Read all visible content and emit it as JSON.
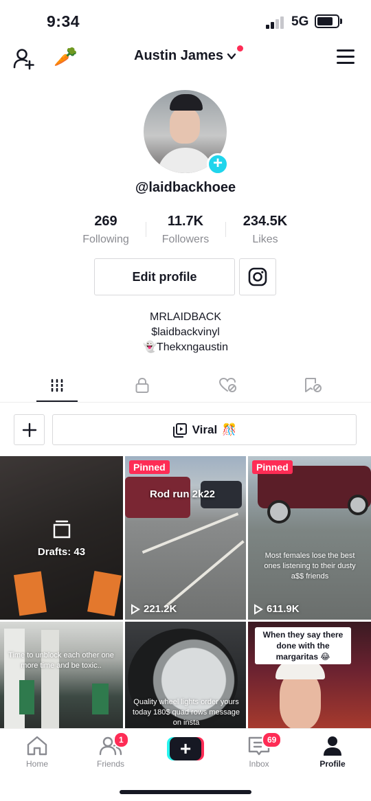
{
  "status_bar": {
    "time": "9:34",
    "network": "5G"
  },
  "header": {
    "title": "Austin James"
  },
  "profile": {
    "handle": "@laidbackhoee",
    "stats": [
      {
        "value": "269",
        "label": "Following"
      },
      {
        "value": "11.7K",
        "label": "Followers"
      },
      {
        "value": "234.5K",
        "label": "Likes"
      }
    ],
    "edit_label": "Edit profile",
    "bio": [
      "MRLAIDBACK",
      "$laidbackvinyl",
      "👻Thekxngaustin"
    ]
  },
  "playlist": {
    "label": "Viral",
    "emoji": "🎊"
  },
  "videos": [
    {
      "drafts_label": "Drafts: 43"
    },
    {
      "pinned": "Pinned",
      "overlay": "Rod run 2k22",
      "views": "221.2K"
    },
    {
      "pinned": "Pinned",
      "caption": "Most females lose the best ones listening to their dusty a$$ friends",
      "views": "611.9K"
    },
    {
      "caption": "Time to unblock each other one more time and be toxic.."
    },
    {
      "caption": "Quality wheel lights order yours today 180$ quad rows message on insta"
    },
    {
      "label": "When they say there done with the margaritas 😂"
    }
  ],
  "bottom_nav": {
    "home": "Home",
    "friends": "Friends",
    "friends_badge": "1",
    "inbox": "Inbox",
    "inbox_badge": "69",
    "profile": "Profile"
  },
  "colors": {
    "accent": "#fe2c55",
    "cyan": "#20d5ec",
    "text": "#161823",
    "muted": "#8a8b91"
  }
}
